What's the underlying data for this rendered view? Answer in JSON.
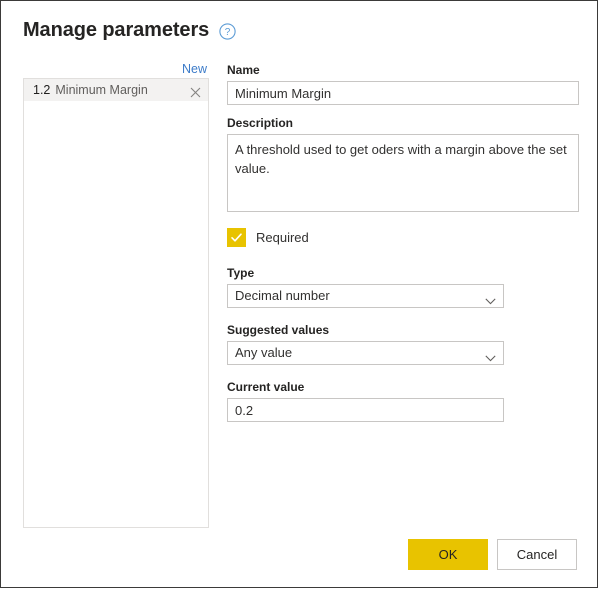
{
  "dialog": {
    "title": "Manage parameters",
    "help_icon": "help-circle-icon"
  },
  "list_panel": {
    "new_label": "New",
    "items": [
      {
        "order": "1.2",
        "label": "Minimum Margin",
        "close_icon": "close-icon"
      }
    ]
  },
  "form": {
    "name": {
      "label": "Name",
      "value": "Minimum Margin",
      "placeholder": ""
    },
    "description": {
      "label": "Description",
      "value": "A threshold used to get oders with a margin above the set value.",
      "placeholder": ""
    },
    "required": {
      "label": "Required",
      "checked": true,
      "check_icon": "checkmark-icon"
    },
    "type": {
      "label": "Type",
      "value": "Decimal number",
      "chevron_icon": "chevron-down-icon"
    },
    "suggested_values": {
      "label": "Suggested values",
      "value": "Any value",
      "chevron_icon": "chevron-down-icon"
    },
    "current_value": {
      "label": "Current value",
      "value": "0.2",
      "placeholder": ""
    }
  },
  "footer": {
    "ok_label": "OK",
    "cancel_label": "Cancel"
  },
  "colors": {
    "accent": "#e8c300",
    "link": "#3d7cc9",
    "border": "#c8c6c4",
    "panel_border": "#e1dfdd",
    "selected_row": "#f3f2f1",
    "text": "#252423"
  }
}
